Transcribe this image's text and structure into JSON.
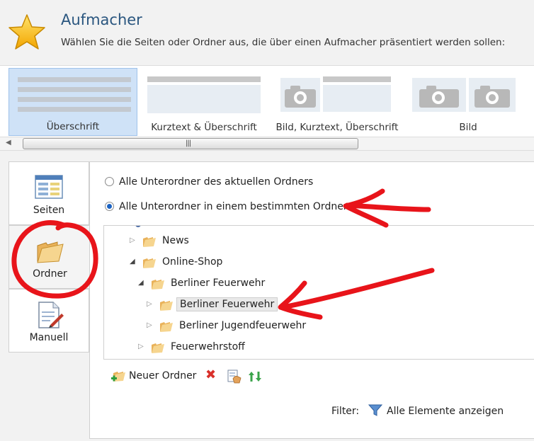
{
  "header": {
    "title": "Aufmacher",
    "subtitle": "Wählen Sie die Seiten oder Ordner aus, die über einen Aufmacher präsentiert werden sollen:"
  },
  "layouts": [
    {
      "label": "Überschrift",
      "selected": true
    },
    {
      "label": "Kurztext & Überschrift",
      "selected": false
    },
    {
      "label": "Bild, Kurztext, Überschrift",
      "selected": false
    },
    {
      "label": "Bild",
      "selected": false
    }
  ],
  "side_tabs": [
    {
      "label": "Seiten",
      "icon": "page-list-icon"
    },
    {
      "label": "Ordner",
      "icon": "folder-icon",
      "active": true
    },
    {
      "label": "Manuell",
      "icon": "document-pen-icon"
    }
  ],
  "options": [
    {
      "label": "Alle Unterordner des aktuellen Ordners",
      "selected": false
    },
    {
      "label": "Alle Unterordner in einem bestimmten Ordner",
      "selected": true
    }
  ],
  "tree": [
    {
      "label": "News",
      "expanded": false
    },
    {
      "label": "Online-Shop",
      "expanded": true
    },
    {
      "label": "Berliner Feuerwehr",
      "expanded": true
    },
    {
      "label": "Berliner Feuerwehr",
      "expanded": false,
      "selected": true
    },
    {
      "label": "Berliner Jugendfeuerwehr",
      "expanded": false
    },
    {
      "label": "Feuerwehrstoff",
      "expanded": false
    }
  ],
  "toolbar": {
    "new_folder": "Neuer Ordner"
  },
  "filter": {
    "label": "Filter:",
    "value": "Alle Elemente anzeigen"
  },
  "colors": {
    "title": "#2a567f",
    "selected_tile": "#cfe2f7",
    "annotation": "#e8141a"
  }
}
